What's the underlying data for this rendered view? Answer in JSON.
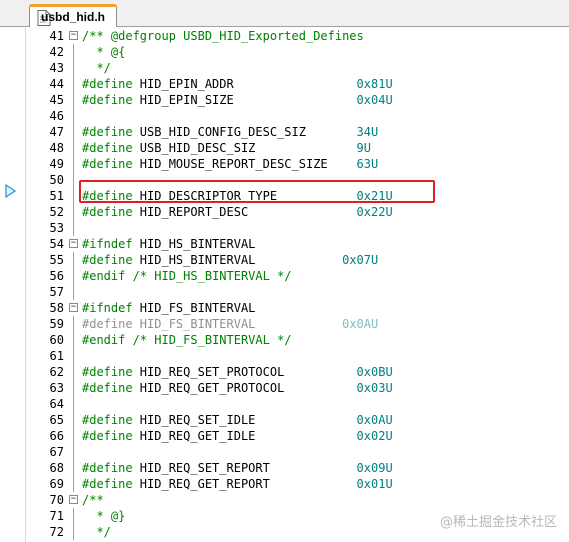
{
  "tab": {
    "label": "usbd_hid.h",
    "icon": "file-icon"
  },
  "highlight": {
    "line": "49",
    "color": "#e02020"
  },
  "watermark": "@稀土掘金技术社区",
  "lines": [
    {
      "n": "41",
      "fold": "minus",
      "parts": [
        [
          "cm",
          "/** @defgroup USBD_HID_Exported_Defines"
        ]
      ]
    },
    {
      "n": "42",
      "parts": [
        [
          "cm",
          "  * @{"
        ]
      ]
    },
    {
      "n": "43",
      "parts": [
        [
          "cm",
          "  */"
        ]
      ]
    },
    {
      "n": "44",
      "parts": [
        [
          "kw",
          "#define "
        ],
        [
          "dx",
          "HID_EPIN_ADDR                 "
        ],
        [
          "num",
          "0x81U"
        ]
      ]
    },
    {
      "n": "45",
      "parts": [
        [
          "kw",
          "#define "
        ],
        [
          "dx",
          "HID_EPIN_SIZE                 "
        ],
        [
          "num",
          "0x04U"
        ]
      ]
    },
    {
      "n": "46",
      "parts": []
    },
    {
      "n": "47",
      "parts": [
        [
          "kw",
          "#define "
        ],
        [
          "dx",
          "USB_HID_CONFIG_DESC_SIZ       "
        ],
        [
          "num",
          "34U"
        ]
      ]
    },
    {
      "n": "48",
      "parts": [
        [
          "kw",
          "#define "
        ],
        [
          "dx",
          "USB_HID_DESC_SIZ              "
        ],
        [
          "num",
          "9U"
        ]
      ]
    },
    {
      "n": "49",
      "parts": [
        [
          "kw",
          "#define "
        ],
        [
          "dx",
          "HID_MOUSE_REPORT_DESC_SIZE    "
        ],
        [
          "num",
          "63U"
        ]
      ]
    },
    {
      "n": "50",
      "parts": []
    },
    {
      "n": "51",
      "parts": [
        [
          "kw",
          "#define "
        ],
        [
          "dx",
          "HID_DESCRIPTOR_TYPE           "
        ],
        [
          "num",
          "0x21U"
        ]
      ]
    },
    {
      "n": "52",
      "parts": [
        [
          "kw",
          "#define "
        ],
        [
          "dx",
          "HID_REPORT_DESC               "
        ],
        [
          "num",
          "0x22U"
        ]
      ]
    },
    {
      "n": "53",
      "parts": []
    },
    {
      "n": "54",
      "fold": "minus",
      "parts": [
        [
          "kw",
          "#ifndef "
        ],
        [
          "dx",
          "HID_HS_BINTERVAL"
        ]
      ]
    },
    {
      "n": "55",
      "parts": [
        [
          "kw",
          "#define "
        ],
        [
          "dx",
          "HID_HS_BINTERVAL            "
        ],
        [
          "num",
          "0x07U"
        ]
      ]
    },
    {
      "n": "56",
      "parts": [
        [
          "kw",
          "#endif "
        ],
        [
          "cm",
          "/* "
        ],
        [
          "kw",
          "HID_HS_BINTERVAL"
        ],
        [
          "cm",
          " */"
        ]
      ]
    },
    {
      "n": "57",
      "parts": []
    },
    {
      "n": "58",
      "fold": "minus",
      "parts": [
        [
          "kw",
          "#ifndef "
        ],
        [
          "dx",
          "HID_FS_BINTERVAL"
        ]
      ]
    },
    {
      "n": "59",
      "parts": [
        [
          "dim",
          "#define "
        ],
        [
          "dim",
          "HID_FS_BINTERVAL            "
        ],
        [
          "dim-num",
          "0x0AU"
        ]
      ]
    },
    {
      "n": "60",
      "parts": [
        [
          "kw",
          "#endif "
        ],
        [
          "cm",
          "/* "
        ],
        [
          "kw",
          "HID_FS_BINTERVAL"
        ],
        [
          "cm",
          " */"
        ]
      ]
    },
    {
      "n": "61",
      "parts": []
    },
    {
      "n": "62",
      "parts": [
        [
          "kw",
          "#define "
        ],
        [
          "dx",
          "HID_REQ_SET_PROTOCOL          "
        ],
        [
          "num",
          "0x0BU"
        ]
      ]
    },
    {
      "n": "63",
      "parts": [
        [
          "kw",
          "#define "
        ],
        [
          "dx",
          "HID_REQ_GET_PROTOCOL          "
        ],
        [
          "num",
          "0x03U"
        ]
      ]
    },
    {
      "n": "64",
      "parts": []
    },
    {
      "n": "65",
      "parts": [
        [
          "kw",
          "#define "
        ],
        [
          "dx",
          "HID_REQ_SET_IDLE              "
        ],
        [
          "num",
          "0x0AU"
        ]
      ]
    },
    {
      "n": "66",
      "parts": [
        [
          "kw",
          "#define "
        ],
        [
          "dx",
          "HID_REQ_GET_IDLE              "
        ],
        [
          "num",
          "0x02U"
        ]
      ]
    },
    {
      "n": "67",
      "parts": []
    },
    {
      "n": "68",
      "parts": [
        [
          "kw",
          "#define "
        ],
        [
          "dx",
          "HID_REQ_SET_REPORT            "
        ],
        [
          "num",
          "0x09U"
        ]
      ]
    },
    {
      "n": "69",
      "parts": [
        [
          "kw",
          "#define "
        ],
        [
          "dx",
          "HID_REQ_GET_REPORT            "
        ],
        [
          "num",
          "0x01U"
        ]
      ]
    },
    {
      "n": "70",
      "fold": "minus",
      "parts": [
        [
          "cm",
          "/**"
        ]
      ]
    },
    {
      "n": "71",
      "parts": [
        [
          "cm",
          "  * @}"
        ]
      ]
    },
    {
      "n": "72",
      "parts": [
        [
          "cm",
          "  */"
        ]
      ]
    }
  ]
}
